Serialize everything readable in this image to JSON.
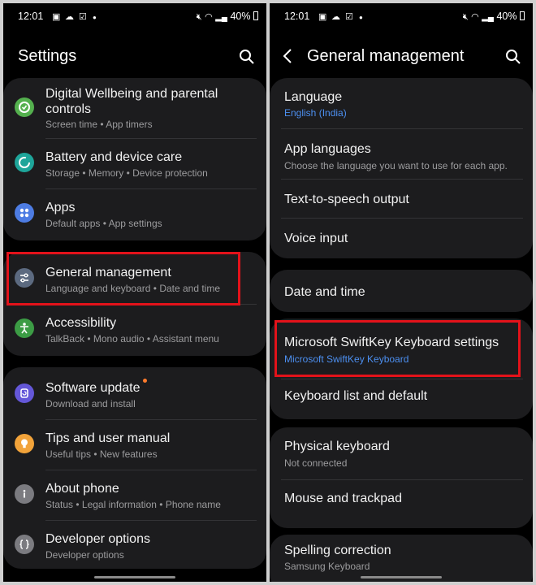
{
  "status_bar": {
    "time": "12:01",
    "battery": "40%"
  },
  "left": {
    "title": "Settings",
    "items": [
      {
        "label": "Digital Wellbeing and parental controls",
        "sub": "Screen time  •  App timers",
        "icon": "digital-wellbeing-icon",
        "color": "#54b04e"
      },
      {
        "label": "Battery and device care",
        "sub": "Storage  •  Memory  •  Device protection",
        "icon": "device-care-icon",
        "color": "#1ea59a"
      },
      {
        "label": "Apps",
        "sub": "Default apps  •  App settings",
        "icon": "apps-icon",
        "color": "#4d7ce3"
      },
      {
        "label": "General management",
        "sub": "Language and keyboard  •  Date and time",
        "icon": "sliders-icon",
        "color": "#5c6a80"
      },
      {
        "label": "Accessibility",
        "sub": "TalkBack  •  Mono audio  •  Assistant menu",
        "icon": "accessibility-icon",
        "color": "#3c9c45"
      },
      {
        "label": "Software update",
        "sub": "Download and install",
        "icon": "software-update-icon",
        "color": "#6457d8"
      },
      {
        "label": "Tips and user manual",
        "sub": "Useful tips  •  New features",
        "icon": "lightbulb-icon",
        "color": "#f2a33a"
      },
      {
        "label": "About phone",
        "sub": "Status  •  Legal information  •  Phone name",
        "icon": "info-icon",
        "color": "#7b7b80"
      },
      {
        "label": "Developer options",
        "sub": "Developer options",
        "icon": "braces-icon",
        "color": "#7b7b80"
      }
    ]
  },
  "right": {
    "title": "General management",
    "items": [
      {
        "label": "Language",
        "sub": "English (India)"
      },
      {
        "label": "App languages",
        "sub": "Choose the language you want to use for each app."
      },
      {
        "label": "Text-to-speech output"
      },
      {
        "label": "Voice input"
      },
      {
        "label": "Date and time"
      },
      {
        "label": "Microsoft SwiftKey Keyboard settings",
        "sub": "Microsoft SwiftKey Keyboard"
      },
      {
        "label": "Keyboard list and default"
      },
      {
        "label": "Physical keyboard",
        "sub": "Not connected"
      },
      {
        "label": "Mouse and trackpad"
      },
      {
        "label": "Spelling correction",
        "sub": "Samsung Keyboard"
      }
    ]
  }
}
